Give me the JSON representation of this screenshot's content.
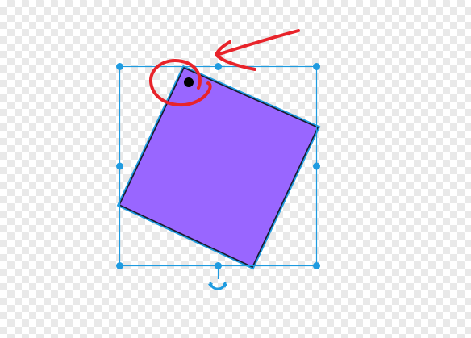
{
  "canvas": {
    "background": "transparent-checkerboard"
  },
  "shape": {
    "type": "rotated-square",
    "fill": "#9966ff",
    "border_inner": "#1a1a2e",
    "border_outer": "#1f9be0"
  },
  "selection": {
    "color": "#1f9be0",
    "handle_count": 8,
    "rotate_handle_icon": "rotate-arrow-icon"
  },
  "annotation": {
    "color": "#e8232a",
    "marks": [
      "circle-around-corner",
      "arrow-pointing-to-corner"
    ]
  },
  "corner_marker": {
    "color": "#000000",
    "icon": "black-dot"
  }
}
